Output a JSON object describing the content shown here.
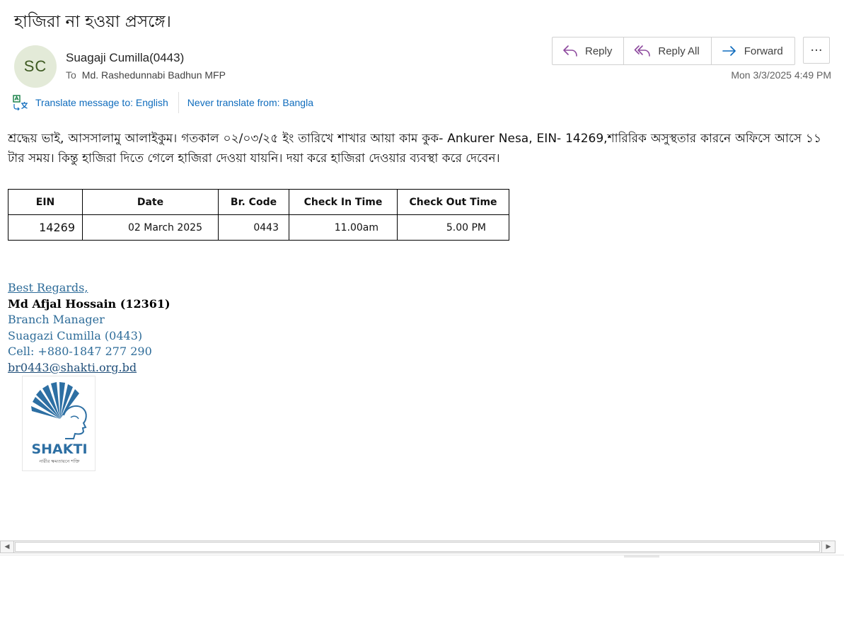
{
  "email": {
    "subject": "হাজিরা না হওয়া প্রসঙ্গে।",
    "sender": {
      "initials": "SC",
      "name": "Suagaji Cumilla(0443)",
      "avatar_bg": "#e3ead8"
    },
    "to_label": "To",
    "to_name": "Md. Rashedunnabi Badhun MFP",
    "timestamp": "Mon 3/3/2025 4:49 PM"
  },
  "actions": {
    "reply": "Reply",
    "reply_all": "Reply All",
    "forward": "Forward",
    "more": "···"
  },
  "translate": {
    "translate_to": "Translate message to: English",
    "never_translate": "Never translate from: Bangla"
  },
  "body": {
    "paragraph": "শ্রদ্ধেয় ভাই, আসসালামু আলাইকুম। গতকাল ০২/০৩/২৫ ইং তারিখে শাখার  আয়া কাম কুক- Ankurer Nesa, EIN- 14269,শারিরিক অসুস্থতার কারনে অফিসে আসে ১১ টার সময়। কিন্তু হাজিরা দিতে গেলে হাজিরা দেওয়া যায়নি। দয়া করে হাজিরা দেওয়ার ব্যবস্থা  করে দেবেন।"
  },
  "table": {
    "headers": [
      "EIN",
      "Date",
      "Br. Code",
      "Check In Time",
      "Check Out Time"
    ],
    "rows": [
      [
        "14269",
        "02 March 2025",
        "0443",
        "11.00am",
        "5.00 PM"
      ]
    ]
  },
  "signature": {
    "regards": "Best Regards,",
    "name": "Md Afjal Hossain (12361)",
    "title": "Branch Manager",
    "branch": "Suagazi Cumilla (0443)",
    "cell": "Cell: +880-1847 277 290",
    "email": "br0443@shakti.org.bd"
  },
  "logo": {
    "wordmark": "SHAKTI",
    "tagline": "নারীর ক্ষমতায়নে শক্তি",
    "color": "#2d6fa3"
  },
  "colors": {
    "link": "#0f6cbd",
    "signature": "#2e6c99",
    "reply_icon": "#8e4a9e",
    "forward_icon": "#0f6cbd"
  }
}
